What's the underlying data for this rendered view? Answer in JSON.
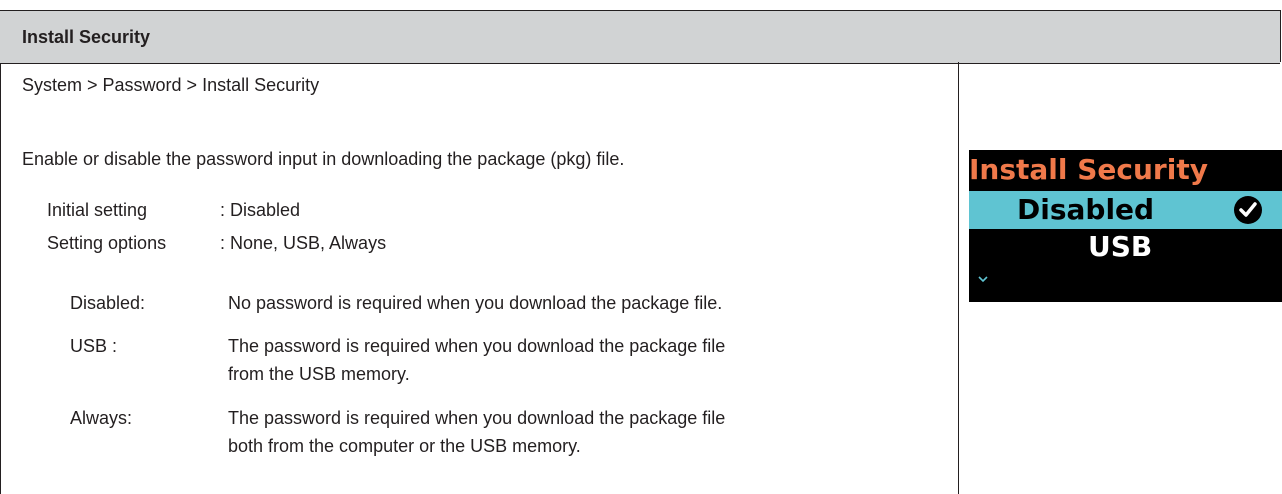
{
  "header": {
    "title": "Install Security"
  },
  "breadcrumb": "System > Password > Install Security",
  "description": "Enable or disable the password input in downloading the package (pkg) file.",
  "settings": {
    "initial_label": "Initial setting",
    "initial_value": ": Disabled",
    "options_label": "Setting options",
    "options_value": ": None, USB, Always"
  },
  "options": [
    {
      "term": "Disabled:",
      "desc_lines": [
        "No password is required when you download the package file."
      ]
    },
    {
      "term": "USB :",
      "desc_lines": [
        "The password is required when you download the package file",
        "from the USB memory."
      ]
    },
    {
      "term": "Always:",
      "desc_lines": [
        "The password is required when you download the package file",
        "both from the computer or the USB memory."
      ]
    }
  ],
  "device_screen": {
    "title": "Install Security",
    "selected_option": "Disabled",
    "next_option": "USB",
    "colors": {
      "background": "#000000",
      "title": "#f0794a",
      "highlight": "#5fc4d2",
      "text": "#ffffff"
    },
    "icons": [
      "check-circle-icon",
      "chevron-down-icon"
    ]
  }
}
